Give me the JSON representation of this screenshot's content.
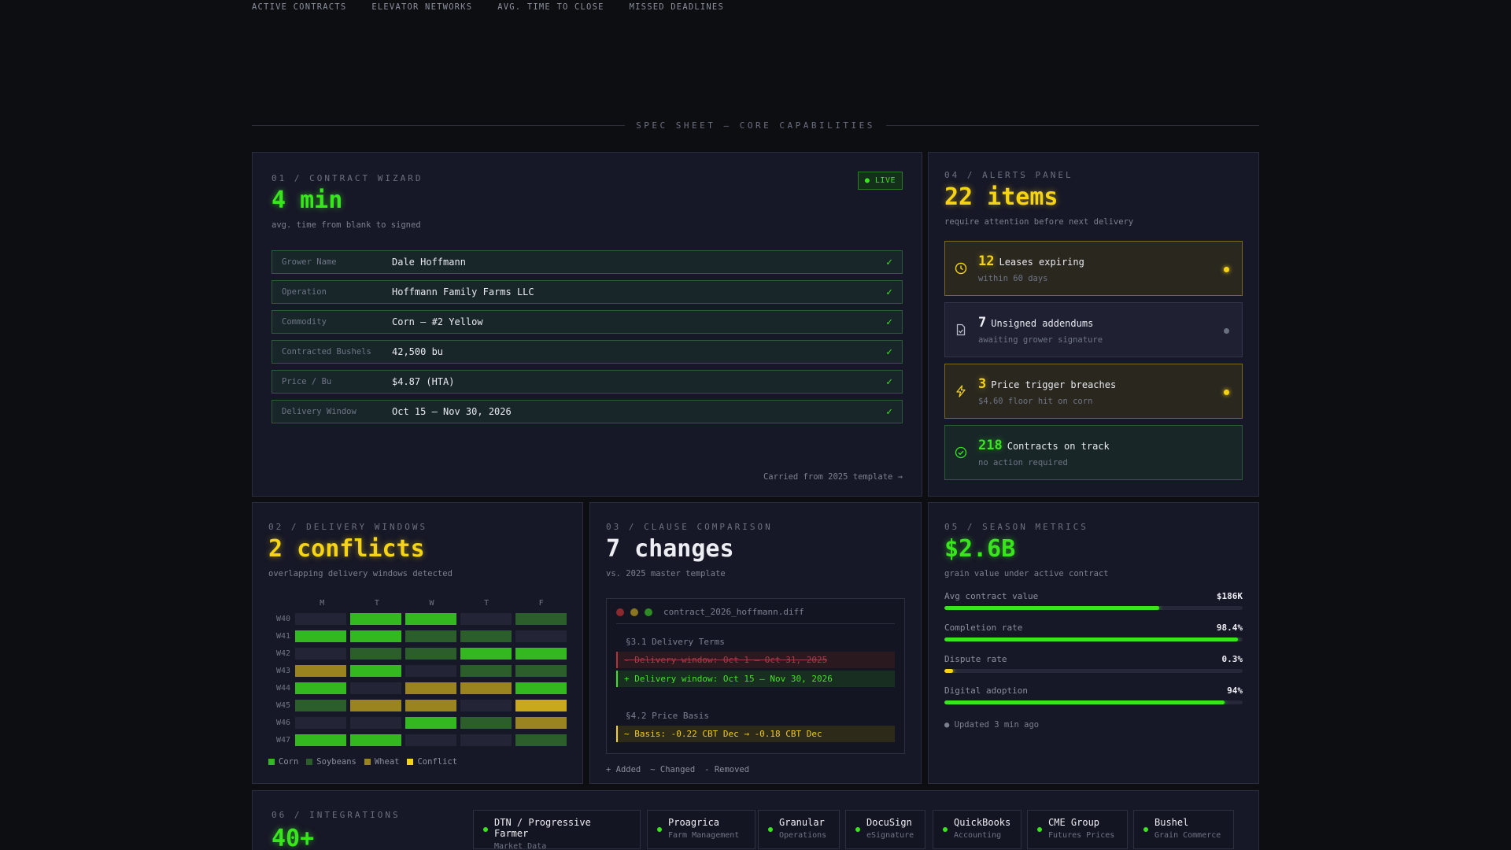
{
  "topnav": [
    "ACTIVE CONTRACTS",
    "ELEVATOR NETWORKS",
    "AVG. TIME TO CLOSE",
    "MISSED DEADLINES"
  ],
  "spec_header": "SPEC SHEET — CORE CAPABILITIES",
  "wizard": {
    "label": "01 / CONTRACT WIZARD",
    "value": "4 min",
    "sub": "avg. time from blank to signed",
    "live": "● LIVE",
    "fields": [
      {
        "k": "Grower Name",
        "v": "Dale Hoffmann",
        "check": "✓"
      },
      {
        "k": "Operation",
        "v": "Hoffmann Family Farms LLC",
        "check": "✓"
      },
      {
        "k": "Commodity",
        "v": "Corn — #2 Yellow",
        "check": "✓"
      },
      {
        "k": "Contracted Bushels",
        "v": "42,500 bu",
        "check": "✓"
      },
      {
        "k": "Price / Bu",
        "v": "$4.87 (HTA)",
        "check": "✓"
      },
      {
        "k": "Delivery Window",
        "v": "Oct 15 – Nov 30, 2026",
        "check": "✓"
      }
    ],
    "carried": "Carried from 2025 template →"
  },
  "alerts": {
    "label": "04 / ALERTS PANEL",
    "value": "22 items",
    "sub": "require attention before next delivery",
    "items": [
      {
        "num": "12",
        "title": "Leases expiring",
        "sub": "within 60 days",
        "icon": "clock-icon",
        "style": "warn"
      },
      {
        "num": "7",
        "title": "Unsigned addendums",
        "sub": "awaiting grower signature",
        "icon": "document-icon",
        "style": "neutral"
      },
      {
        "num": "3",
        "title": "Price trigger breaches",
        "sub": "$4.60 floor hit on corn",
        "icon": "lightning-icon",
        "style": "warn"
      },
      {
        "num": "218",
        "title": "Contracts on track",
        "sub": "no action required",
        "icon": "check-circle-icon",
        "style": "ok"
      }
    ]
  },
  "delivery": {
    "label": "02 / DELIVERY WINDOWS",
    "value": "2 conflicts",
    "sub": "overlapping delivery windows detected",
    "days": [
      "M",
      "T",
      "W",
      "T",
      "F"
    ],
    "weeks": [
      {
        "wk": "W40",
        "cells": [
          "empty",
          "corn",
          "corn",
          "empty",
          "soy"
        ]
      },
      {
        "wk": "W41",
        "cells": [
          "corn",
          "corn",
          "soy",
          "soy",
          "empty"
        ]
      },
      {
        "wk": "W42",
        "cells": [
          "empty",
          "soy",
          "soy",
          "corn",
          "corn"
        ]
      },
      {
        "wk": "W43",
        "cells": [
          "wheat",
          "corn",
          "empty",
          "soy",
          "soy"
        ]
      },
      {
        "wk": "W44",
        "cells": [
          "corn",
          "empty",
          "wheat",
          "wheat",
          "corn"
        ]
      },
      {
        "wk": "W45",
        "cells": [
          "soy",
          "wheat",
          "wheat",
          "empty",
          "conflict"
        ]
      },
      {
        "wk": "W46",
        "cells": [
          "empty",
          "empty",
          "corn",
          "soy",
          "wheat"
        ]
      },
      {
        "wk": "W47",
        "cells": [
          "corn",
          "corn",
          "empty",
          "empty",
          "soy"
        ]
      }
    ],
    "legend": [
      {
        "name": "Corn",
        "key": "corn"
      },
      {
        "name": "Soybeans",
        "key": "soy"
      },
      {
        "name": "Wheat",
        "key": "wheat"
      },
      {
        "name": "Conflict",
        "key": "conflict"
      }
    ],
    "colors": {
      "empty": "#232536",
      "corn": "#33b81f",
      "soy": "#2b5e2b",
      "wheat": "#9a8420",
      "conflict": "#c9a91b",
      "conflict_legend": "#f5d315"
    }
  },
  "clause": {
    "label": "03 / CLAUSE COMPARISON",
    "value": "7 changes",
    "sub": "vs. 2025 master template",
    "filename": "contract_2026_hoffmann.diff",
    "sec1": "§3.1 Delivery Terms",
    "removed": "-  Delivery window: Oct 1 – Oct 31, 2025",
    "added": "+  Delivery window: Oct 15 – Nov 30, 2026",
    "sec2": "§4.2 Price Basis",
    "changed": "~  Basis: -0.22 CBT Dec → -0.18 CBT Dec",
    "legend_added": "+ Added",
    "legend_changed": "~ Changed",
    "legend_removed": "- Removed"
  },
  "metrics": {
    "label": "05 / SEASON METRICS",
    "value": "$2.6B",
    "sub": "grain value under active contract",
    "items": [
      {
        "name": "Avg contract value",
        "value": "$186K",
        "fill": 0.72,
        "color": "#39e61e"
      },
      {
        "name": "Completion rate",
        "value": "98.4%",
        "fill": 0.984,
        "color": "#39e61e"
      },
      {
        "name": "Dispute rate",
        "value": "0.3%",
        "fill": 0.03,
        "color": "#f5d315"
      },
      {
        "name": "Digital adoption",
        "value": "94%",
        "fill": 0.94,
        "color": "#39e61e"
      }
    ],
    "updated": "● Updated 3 min ago"
  },
  "integrations": {
    "label": "06 / INTEGRATIONS",
    "value": "40+",
    "chips": [
      {
        "name": "DTN / Progressive Farmer",
        "sub": "Market Data"
      },
      {
        "name": "Proagrica",
        "sub": "Farm Management"
      },
      {
        "name": "Granular",
        "sub": "Operations"
      },
      {
        "name": "DocuSign",
        "sub": "eSignature"
      },
      {
        "name": "QuickBooks",
        "sub": "Accounting"
      },
      {
        "name": "CME Group",
        "sub": "Futures Prices"
      },
      {
        "name": "Bushel",
        "sub": "Grain Commerce"
      }
    ]
  }
}
